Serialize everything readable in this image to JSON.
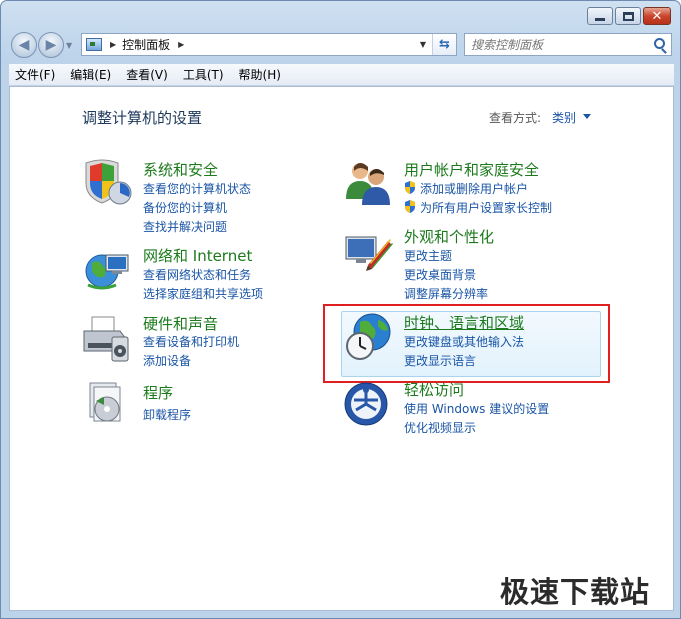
{
  "window": {
    "address_crumb": "控制面板",
    "search_placeholder": "搜索控制面板"
  },
  "menu": [
    "文件(F)",
    "编辑(E)",
    "查看(V)",
    "工具(T)",
    "帮助(H)"
  ],
  "page": {
    "title": "调整计算机的设置",
    "view_by_label": "查看方式:",
    "view_by_value": "类别"
  },
  "categories": {
    "system": {
      "title": "系统和安全",
      "links": [
        "查看您的计算机状态",
        "备份您的计算机",
        "查找并解决问题"
      ]
    },
    "network": {
      "title": "网络和 Internet",
      "links": [
        "查看网络状态和任务",
        "选择家庭组和共享选项"
      ]
    },
    "hardware": {
      "title": "硬件和声音",
      "links": [
        "查看设备和打印机",
        "添加设备"
      ]
    },
    "programs": {
      "title": "程序",
      "links": [
        "卸载程序"
      ]
    },
    "users": {
      "title": "用户帐户和家庭安全",
      "links": [
        "添加或删除用户帐户",
        "为所有用户设置家长控制"
      ]
    },
    "appearance": {
      "title": "外观和个性化",
      "links": [
        "更改主题",
        "更改桌面背景",
        "调整屏幕分辨率"
      ]
    },
    "clock": {
      "title": "时钟、语言和区域",
      "links": [
        "更改键盘或其他输入法",
        "更改显示语言"
      ]
    },
    "ease": {
      "title": "轻松访问",
      "links": [
        "使用 Windows 建议的设置",
        "优化视频显示"
      ]
    }
  },
  "watermark": "极速下载站"
}
